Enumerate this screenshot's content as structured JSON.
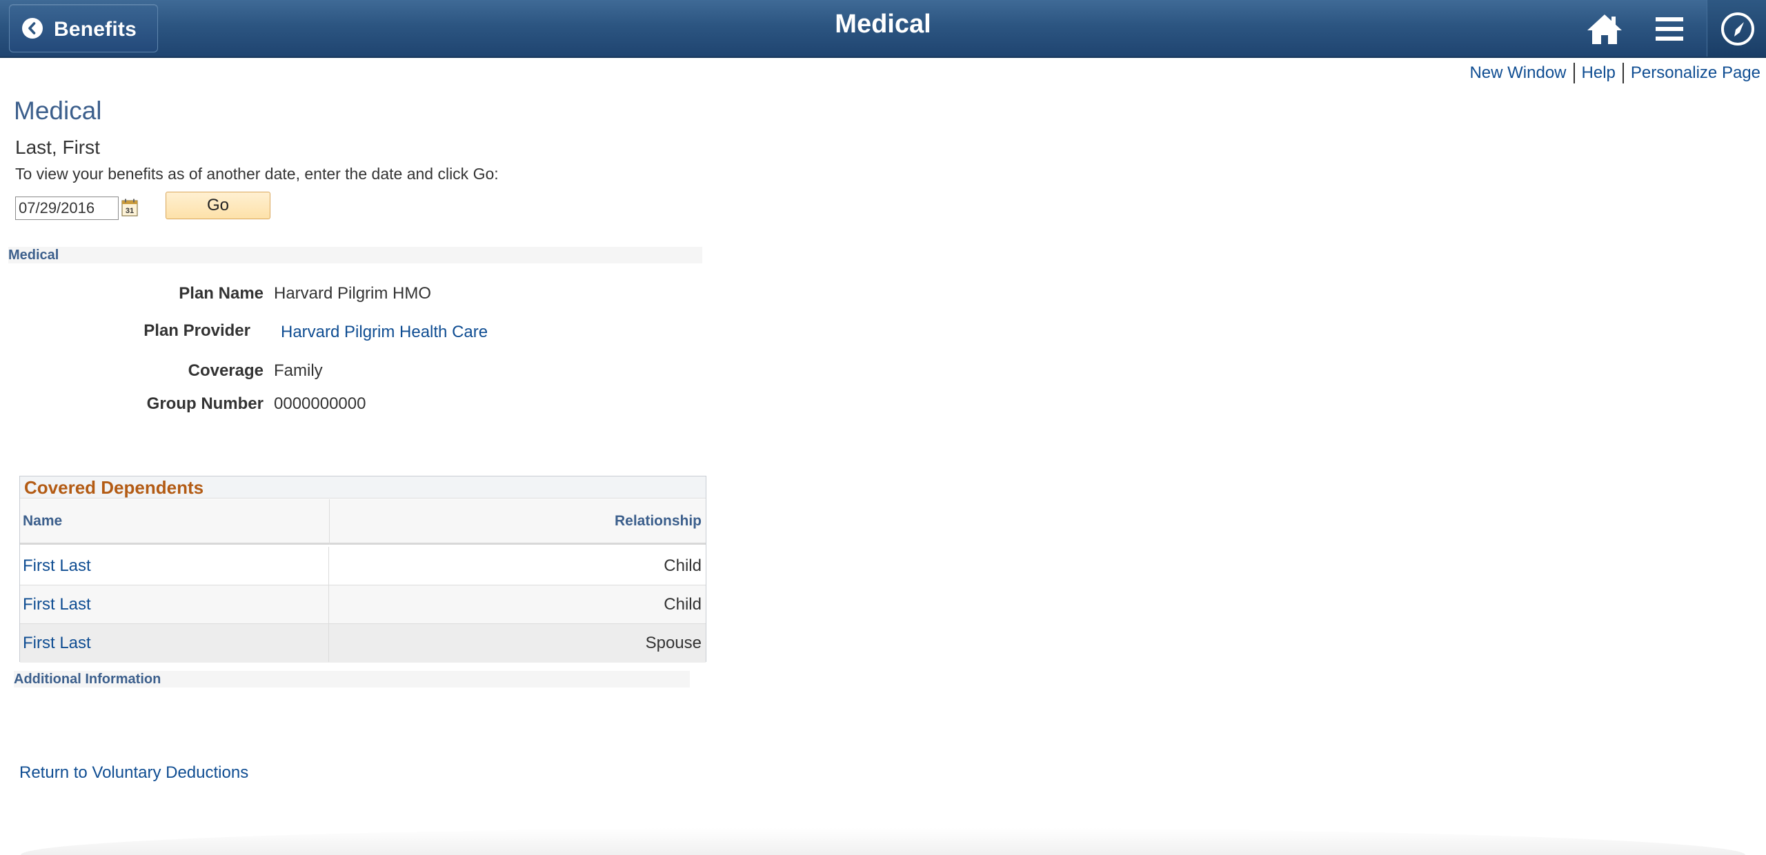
{
  "header": {
    "back_label": "Benefits",
    "title": "Medical",
    "icons": {
      "back": "chevron-left-icon",
      "home": "home-icon",
      "menu": "hamburger-menu-icon",
      "navbar": "compass-icon"
    },
    "colors": {
      "bar": "#2c5581",
      "text": "#ffffff"
    }
  },
  "page_links": {
    "new_window": "New Window",
    "help": "Help",
    "personalize": "Personalize Page"
  },
  "main": {
    "heading": "Medical",
    "person_name": "Last, First",
    "instructions": "To view your benefits as of another date, enter the date and click Go:",
    "date_value": "07/29/2016",
    "calendar_icon": "calendar-icon",
    "go_label": "Go"
  },
  "medical_section": {
    "title": "Medical",
    "plan_name_label": "Plan Name",
    "plan_name": "Harvard Pilgrim HMO",
    "plan_provider_label": "Plan Provider",
    "plan_provider": "Harvard Pilgrim Health Care",
    "coverage_label": "Coverage",
    "coverage": "Family",
    "group_number_label": "Group Number",
    "group_number": "0000000000"
  },
  "covered_dependents": {
    "title": "Covered Dependents",
    "columns": [
      "Name",
      "Relationship"
    ],
    "rows": [
      {
        "name": "First Last",
        "relationship": "Child"
      },
      {
        "name": "First Last",
        "relationship": "Child"
      },
      {
        "name": "First Last",
        "relationship": "Spouse"
      }
    ],
    "title_color": "#b35b14"
  },
  "additional_section": {
    "title": "Additional Information"
  },
  "footer": {
    "return_link": "Return to Voluntary Deductions"
  },
  "colors": {
    "link": "#0f4d92",
    "heading": "#3c5f8c",
    "go_button": "#fde1a9"
  }
}
